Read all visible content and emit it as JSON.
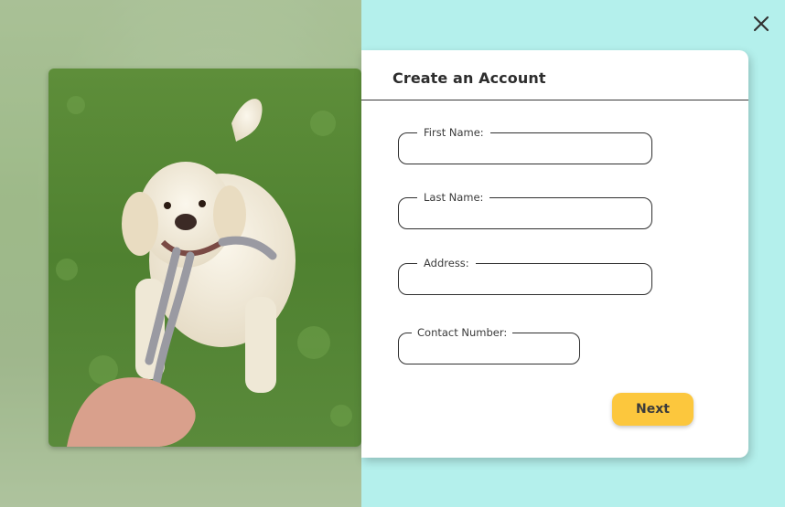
{
  "modal": {
    "title": "Create an Account",
    "fields": [
      {
        "label": "First Name:",
        "value": ""
      },
      {
        "label": "Last Name:",
        "value": ""
      },
      {
        "label": "Address:",
        "value": ""
      },
      {
        "label": "Contact Number:",
        "value": ""
      }
    ],
    "next_label": "Next"
  },
  "icons": {
    "close": "close-icon"
  },
  "colors": {
    "background": "#b4f0ec",
    "button": "#fcc73d",
    "card": "#ffffff"
  }
}
